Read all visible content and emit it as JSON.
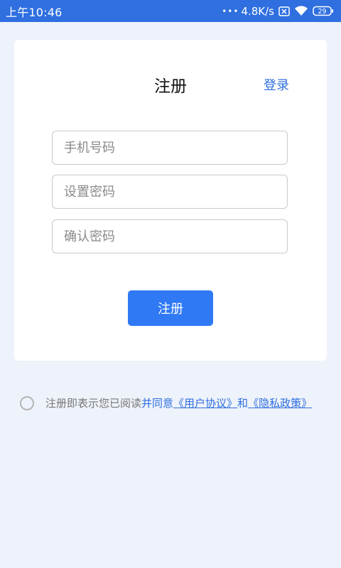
{
  "status_bar": {
    "time": "上午10:46",
    "dots": "•••",
    "network_speed": "4.8K/s",
    "battery": "29",
    "icons": [
      "sim-x-icon",
      "wifi-icon",
      "battery-icon"
    ]
  },
  "card": {
    "title": "注册",
    "login_link": "登录"
  },
  "form": {
    "phone_placeholder": "手机号码",
    "password_placeholder": "设置密码",
    "confirm_placeholder": "确认密码",
    "submit_label": "注册"
  },
  "agreement": {
    "prefix": "注册即表示您已阅读",
    "connector1": "并同意",
    "user_agreement": "《用户协议》",
    "connector2": "和",
    "privacy_policy": "《隐私政策》"
  },
  "colors": {
    "accent": "#2f6fe0",
    "button": "#2f79f5",
    "background": "#eef2fa"
  }
}
